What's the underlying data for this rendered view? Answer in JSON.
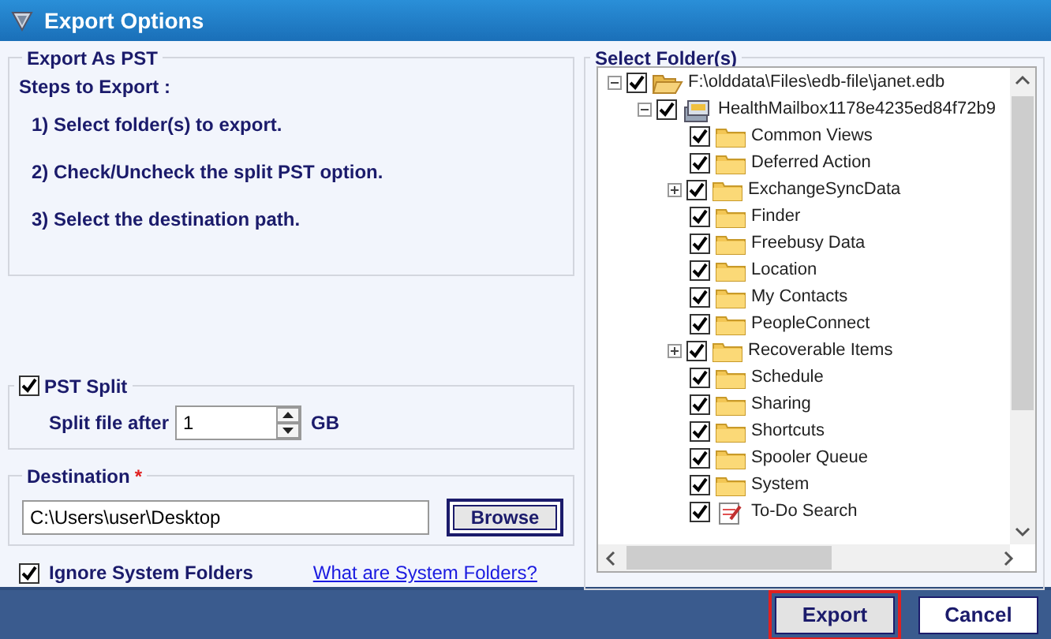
{
  "window": {
    "title": "Export Options"
  },
  "export_as_pst": {
    "title": "Export As PST",
    "steps_heading": "Steps to Export :",
    "steps": [
      "1) Select folder(s) to export.",
      "2) Check/Uncheck the split PST option.",
      "3) Select the destination path."
    ]
  },
  "pst_split": {
    "label": "PST Split",
    "checked": true,
    "split_label": "Split file after",
    "value": "1",
    "unit": "GB"
  },
  "destination": {
    "label": "Destination",
    "required_mark": "*",
    "value": "C:\\Users\\user\\Desktop",
    "browse": "Browse"
  },
  "ignore_system_folders": {
    "label": "Ignore System Folders",
    "checked": true
  },
  "help_link": "What are System Folders?",
  "folder_tree": {
    "title": "Select Folder(s)",
    "items": [
      {
        "label": "F:\\olddata\\Files\\edb-file\\janet.edb",
        "kind": "store",
        "checked": true,
        "expanded": true,
        "children": [
          {
            "label": "HealthMailbox1178e4235ed84f72b9",
            "kind": "mailbox",
            "checked": true,
            "expanded": true,
            "children": [
              {
                "label": "Common Views",
                "kind": "folder",
                "checked": true
              },
              {
                "label": "Deferred Action",
                "kind": "folder",
                "checked": true
              },
              {
                "label": "ExchangeSyncData",
                "kind": "folder",
                "checked": true,
                "expanded": false
              },
              {
                "label": "Finder",
                "kind": "folder",
                "checked": true
              },
              {
                "label": "Freebusy Data",
                "kind": "folder",
                "checked": true
              },
              {
                "label": "Location",
                "kind": "folder",
                "checked": true
              },
              {
                "label": "My Contacts",
                "kind": "folder",
                "checked": true
              },
              {
                "label": "PeopleConnect",
                "kind": "folder",
                "checked": true
              },
              {
                "label": "Recoverable Items",
                "kind": "folder",
                "checked": true,
                "expanded": false
              },
              {
                "label": "Schedule",
                "kind": "folder",
                "checked": true
              },
              {
                "label": "Sharing",
                "kind": "folder",
                "checked": true
              },
              {
                "label": "Shortcuts",
                "kind": "folder",
                "checked": true
              },
              {
                "label": "Spooler Queue",
                "kind": "folder",
                "checked": true
              },
              {
                "label": "System",
                "kind": "folder",
                "checked": true
              },
              {
                "label": "To-Do Search",
                "kind": "search",
                "checked": true
              }
            ]
          }
        ]
      }
    ]
  },
  "buttons": [
    {
      "label": "Export",
      "focused": true
    },
    {
      "label": "Cancel",
      "focused": false
    }
  ]
}
